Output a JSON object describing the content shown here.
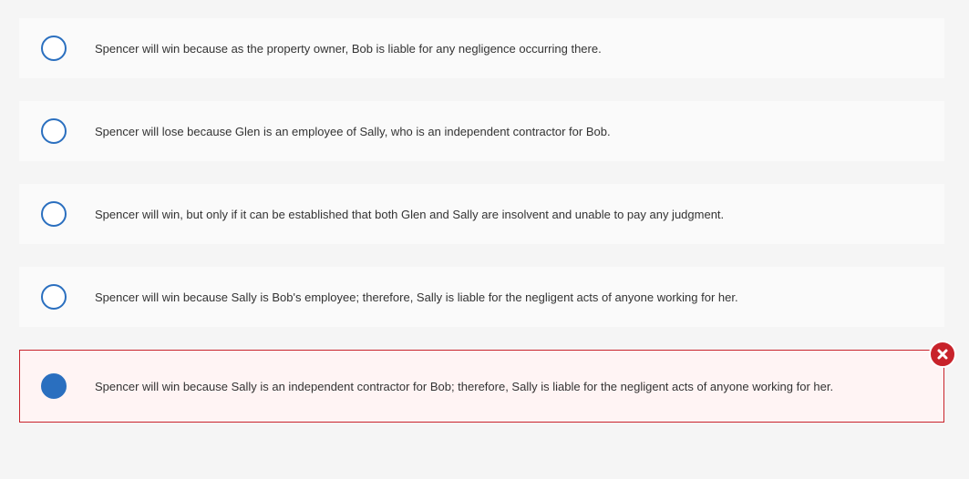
{
  "question": {
    "options": [
      {
        "label": "Spencer will win because as the property owner, Bob is liable for any negligence occurring there.",
        "selected": false
      },
      {
        "label": "Spencer will lose because Glen is an employee of Sally, who is an independent contractor for Bob.",
        "selected": false
      },
      {
        "label": "Spencer will win, but only if it can be established that both Glen and Sally are insolvent and unable to pay any judgment.",
        "selected": false
      },
      {
        "label": "Spencer will win because Sally is Bob's employee; therefore, Sally is liable for the negligent acts of anyone working for her.",
        "selected": false
      },
      {
        "label": "Spencer will win because Sally is an independent contractor for Bob; therefore, Sally is liable for the negligent acts of anyone working for her.",
        "selected": true,
        "status": "incorrect"
      }
    ],
    "incorrect_icon": "x-circle-icon"
  },
  "colors": {
    "radio": "#2a6fbf",
    "incorrect": "#c8232b",
    "incorrect_bg": "#fff4f4",
    "option_bg": "#fafafa",
    "page_bg": "#f5f5f5",
    "text": "#333333"
  }
}
